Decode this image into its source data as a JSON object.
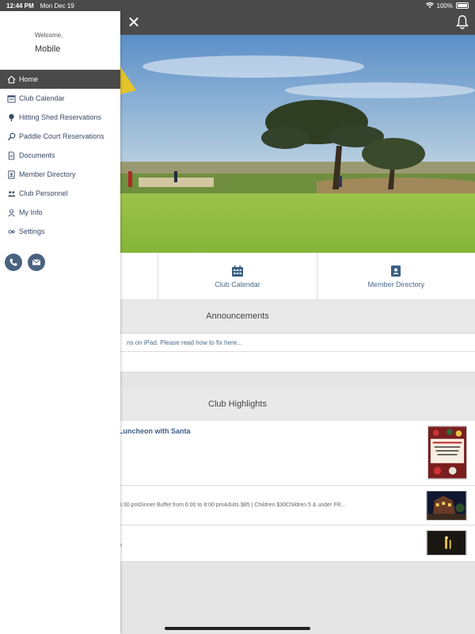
{
  "status": {
    "time": "12:44 PM",
    "date": "Mon Dec 19",
    "battery": "100%"
  },
  "drawer": {
    "welcome": "Welcome,",
    "user_name": "Mobile",
    "items": [
      {
        "label": "Home",
        "icon": "home-icon",
        "active": true
      },
      {
        "label": "Club Calendar",
        "icon": "calendar-icon"
      },
      {
        "label": "Hitting Shed Reservations",
        "icon": "golf-icon"
      },
      {
        "label": "Paddle Court Reservations",
        "icon": "paddle-icon"
      },
      {
        "label": "Documents",
        "icon": "document-icon"
      },
      {
        "label": "Member Directory",
        "icon": "directory-icon"
      },
      {
        "label": "Club Personnel",
        "icon": "people-icon"
      },
      {
        "label": "My Info",
        "icon": "user-icon"
      },
      {
        "label": "Settings",
        "icon": "settings-icon"
      }
    ]
  },
  "quick_links": [
    {
      "label": ""
    },
    {
      "label": "Club Calendar",
      "icon": "calendar-icon"
    },
    {
      "label": "Member Directory",
      "icon": "directory-icon"
    }
  ],
  "announcements": {
    "heading": "Announcements",
    "items": [
      "ns on iPad. Please read how to fix here..."
    ]
  },
  "highlights": {
    "heading": "Club Highlights",
    "items": [
      {
        "title": "Luncheon with Santa",
        "desc": ""
      },
      {
        "title": "",
        "desc": "5:30 pmDinner Buffet from 6:00 to 8:00 pmAdults $85 | Children $30Children 5 & under FR..."
      },
      {
        "title": "",
        "desc": "n"
      }
    ]
  },
  "colors": {
    "dark": "#4a4a4a",
    "accent": "#3b5f86",
    "contact": "#4a6280"
  }
}
